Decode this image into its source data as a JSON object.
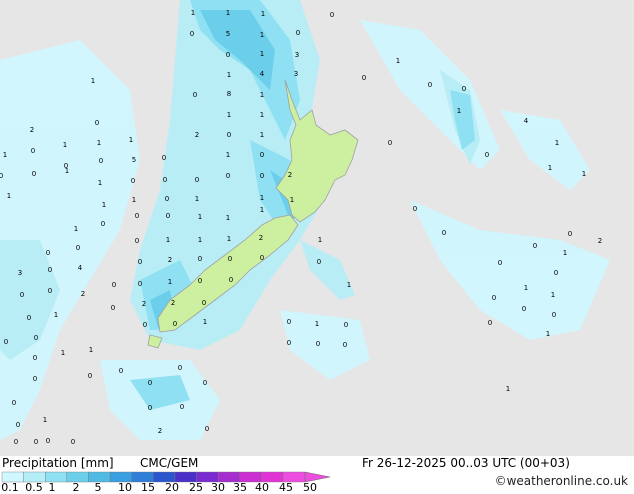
{
  "legend": {
    "title": "Precipitation [mm]",
    "model": "CMC/GEM",
    "valid_time": "Fr 26-12-2025 00..03 UTC (00+03)",
    "credit": "©weatheronline.co.uk",
    "tick_labels": [
      "0.1",
      "0.5",
      "1",
      "2",
      "5",
      "10",
      "15",
      "20",
      "25",
      "30",
      "35",
      "40",
      "45",
      "50"
    ],
    "colors": [
      "#cff7ff",
      "#b4eef8",
      "#8fe0f2",
      "#6bcfec",
      "#4fbbe5",
      "#3a9fe0",
      "#2f7fd9",
      "#2b55cc",
      "#4a2fc8",
      "#7b2cd0",
      "#a62ccf",
      "#cc2fd1",
      "#e235d6",
      "#ee4ee0"
    ]
  },
  "map": {
    "ocean_color": "#e6e6e6",
    "land_color": "#ccf0a0",
    "coast_color": "#a0a0a0",
    "station_values": [
      "1",
      "1",
      "1",
      "0",
      "0",
      "0",
      "5",
      "1",
      "0",
      "1",
      "3",
      "1",
      "4",
      "3",
      "0",
      "1",
      "0",
      "0",
      "8",
      "1",
      "0",
      "1",
      "2",
      "1",
      "1",
      "0",
      "2",
      "0",
      "1",
      "1",
      "4",
      "1",
      "1",
      "1",
      "1",
      "0",
      "1",
      "0",
      "0",
      "5",
      "0",
      "1",
      "0",
      "0",
      "0",
      "1",
      "1",
      "0",
      "0",
      "1",
      "1",
      "0",
      "0",
      "0",
      "0",
      "0",
      "2",
      "1",
      "1",
      "1",
      "0",
      "1",
      "1",
      "1",
      "0",
      "0",
      "0",
      "0",
      "1",
      "1",
      "1",
      "1",
      "2",
      "1",
      "1",
      "1",
      "0",
      "0",
      "0",
      "2",
      "0",
      "0",
      "1",
      "0",
      "1",
      "0",
      "3",
      "0",
      "4",
      "0",
      "2",
      "0",
      "0",
      "0",
      "0",
      "0",
      "1",
      "0",
      "0",
      "2",
      "0",
      "0",
      "1",
      "0",
      "0",
      "1",
      "1",
      "0",
      "0",
      "1",
      "0",
      "2",
      "2",
      "0",
      "1",
      "0",
      "0",
      "0",
      "0",
      "0",
      "1",
      "1",
      "0",
      "0",
      "1",
      "0",
      "0",
      "1",
      "0",
      "0",
      "0",
      "0",
      "0",
      "0",
      "0",
      "0",
      "0",
      "0",
      "0",
      "0",
      "0",
      "1",
      "0",
      "1",
      "2",
      "0",
      "0",
      "0",
      "0",
      "0",
      "0",
      "0",
      "0"
    ]
  }
}
